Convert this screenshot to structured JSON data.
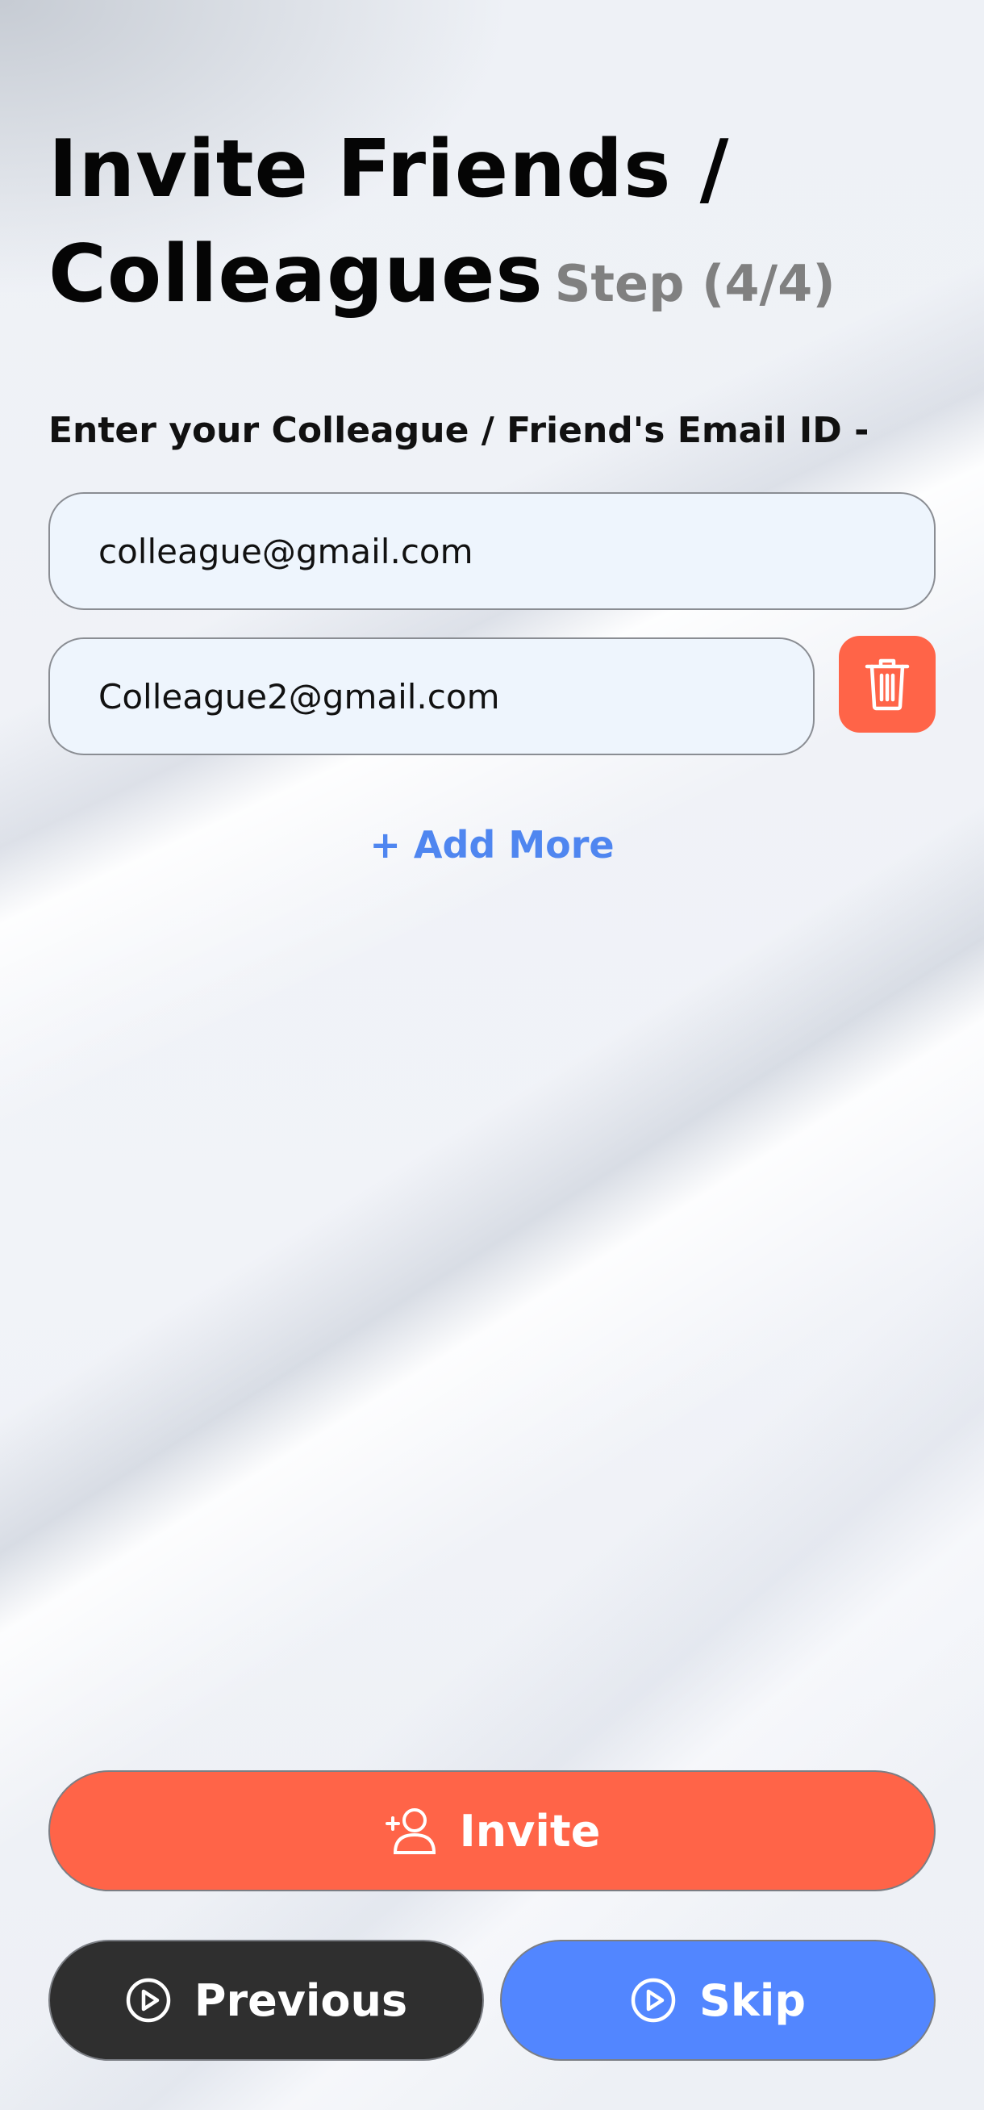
{
  "header": {
    "title_line1": "Invite Friends /",
    "title_line2": "Colleagues",
    "step": "Step (4/4)"
  },
  "form": {
    "label": "Enter your Colleague / Friend's Email ID -",
    "emails": [
      "colleague@gmail.com",
      "Colleague2@gmail.com"
    ],
    "add_more_label": "+ Add More"
  },
  "actions": {
    "invite_label": "Invite",
    "previous_label": "Previous",
    "skip_label": "Skip"
  },
  "icons": {
    "delete": "trash-icon",
    "invite": "add-user-icon",
    "previous": "play-circle-icon",
    "skip": "play-circle-icon"
  },
  "colors": {
    "accent_orange": "#ff6448",
    "link_blue": "#4f86f0",
    "skip_blue": "#5286ff",
    "dark_button": "#2f2f2f",
    "step_gray": "#808080",
    "input_bg": "#eef5fd"
  }
}
